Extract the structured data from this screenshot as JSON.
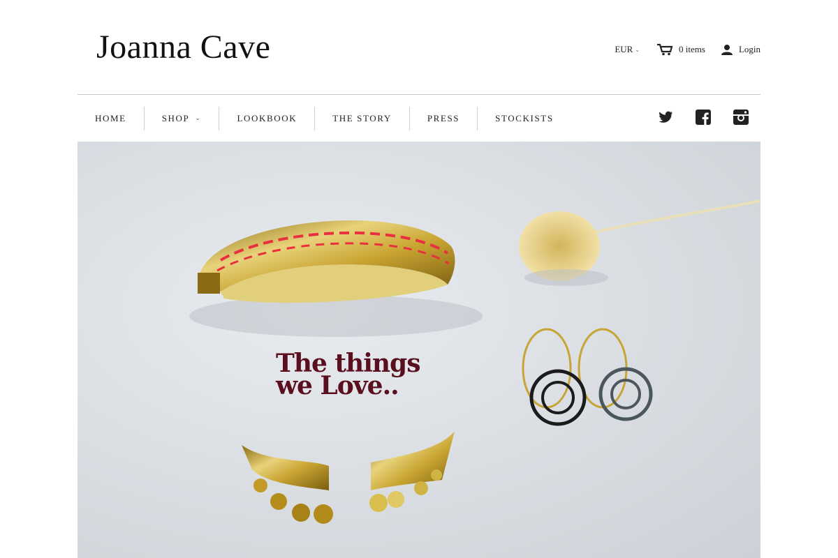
{
  "header": {
    "logo_text": "Joanna Cave",
    "currency": "EUR",
    "cart_label": "0 items",
    "login_label": "Login"
  },
  "nav": {
    "items": [
      {
        "label": "HOME",
        "has_dropdown": false
      },
      {
        "label": "SHOP",
        "has_dropdown": true
      },
      {
        "label": "LOOKBOOK",
        "has_dropdown": false
      },
      {
        "label": "THE STORY",
        "has_dropdown": false
      },
      {
        "label": "PRESS",
        "has_dropdown": false
      },
      {
        "label": "STOCKISTS",
        "has_dropdown": false
      }
    ],
    "social_icons": [
      "twitter-icon",
      "facebook-icon",
      "instagram-icon"
    ]
  },
  "hero": {
    "line1": "The things",
    "line2": "we Love..",
    "text_color": "#5a0f1f"
  }
}
